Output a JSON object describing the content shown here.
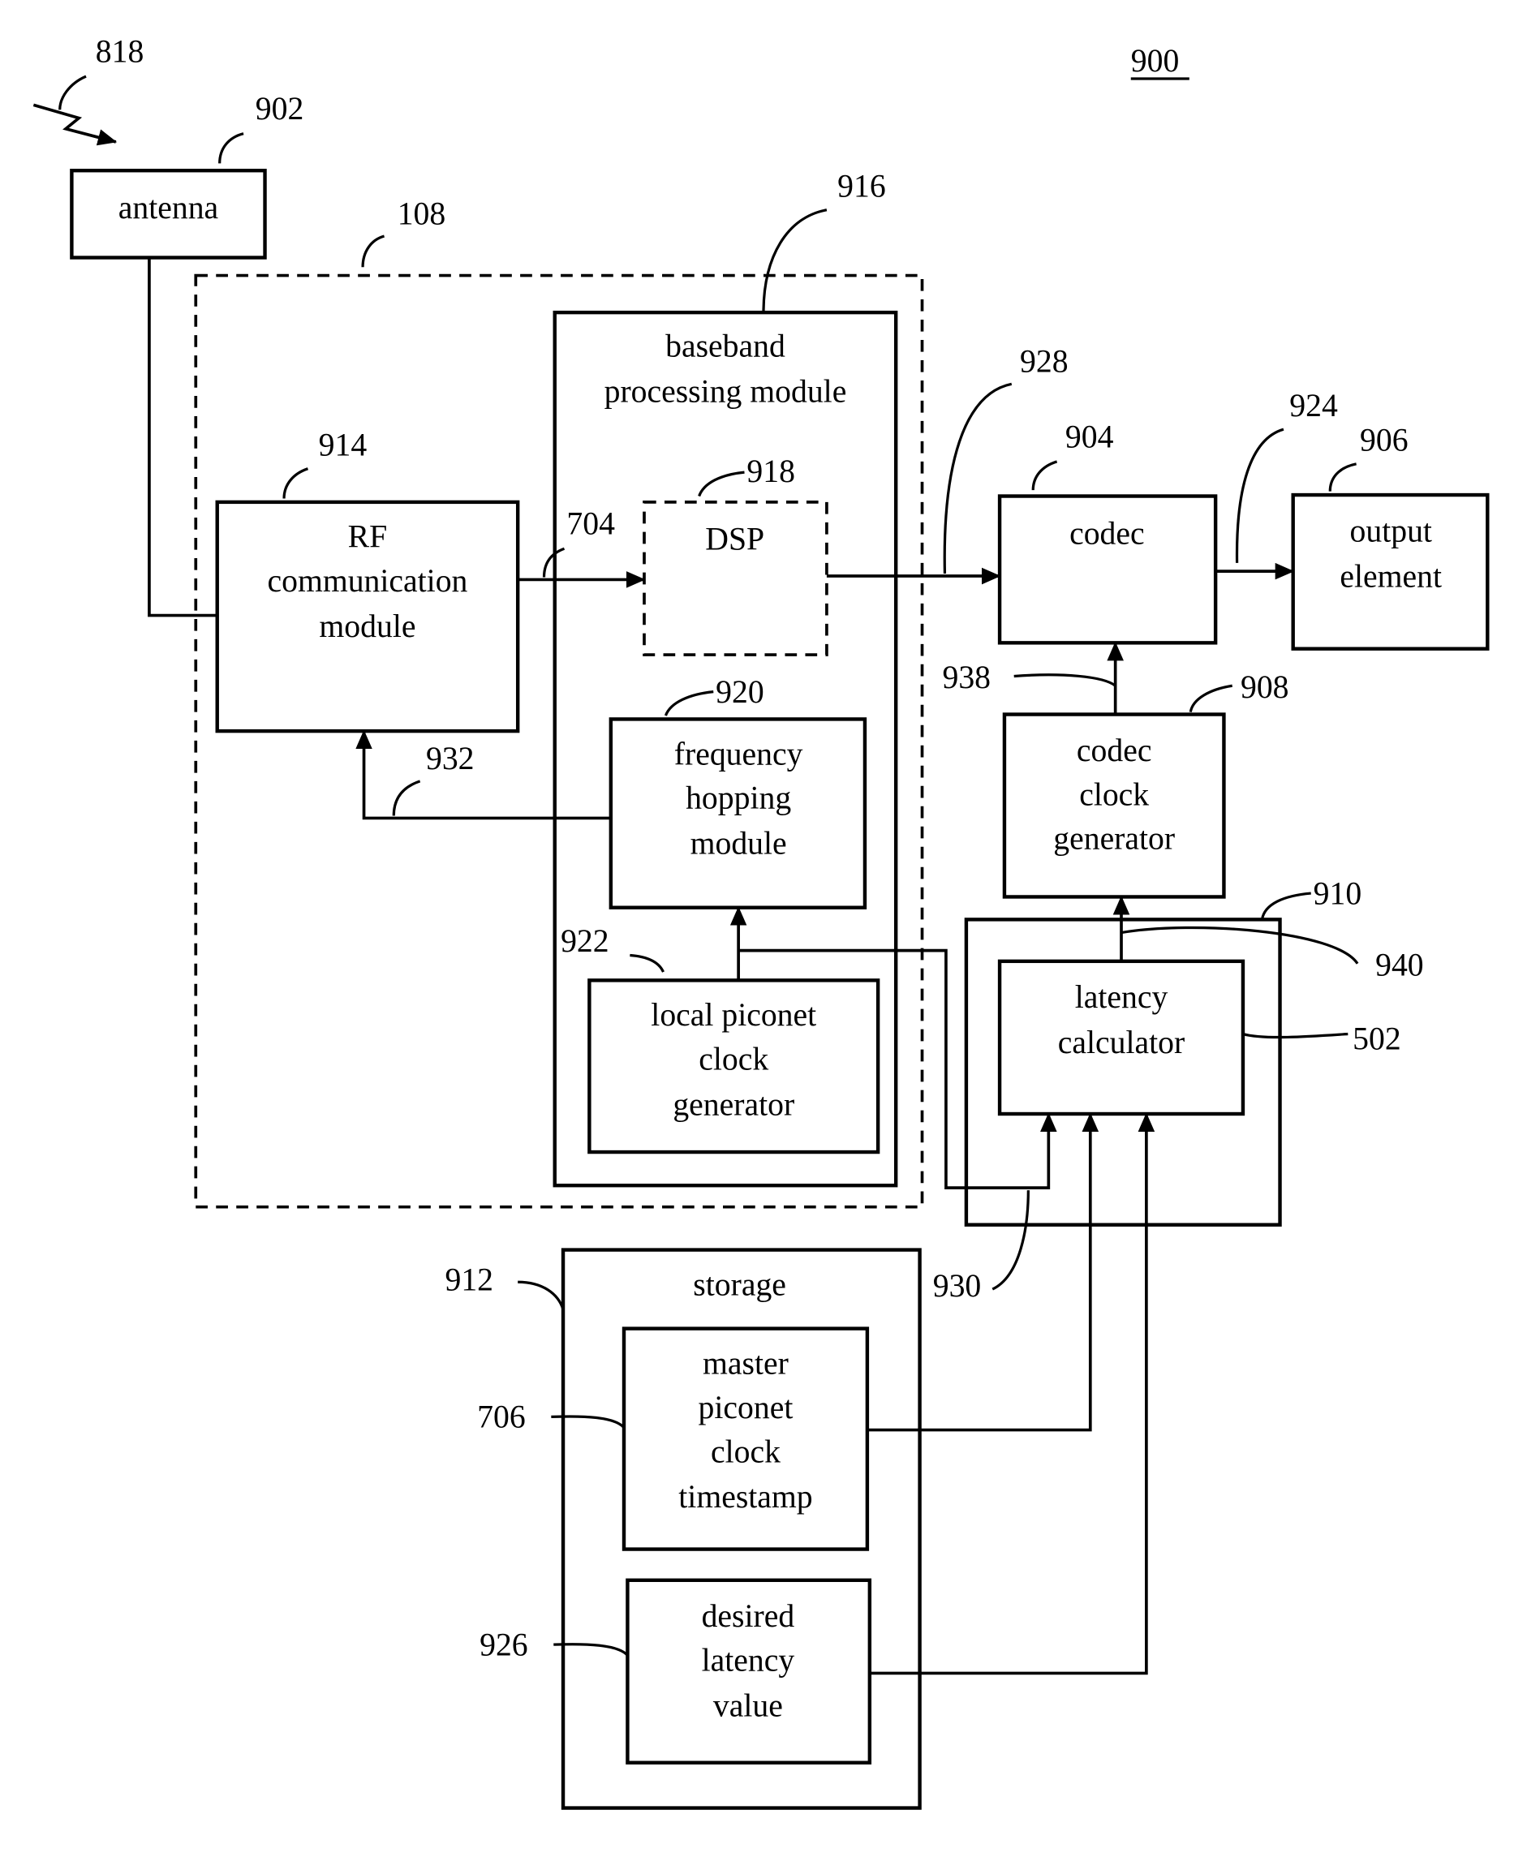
{
  "figure": {
    "figure_number": "900",
    "signal_ref": "818"
  },
  "blocks": {
    "antenna": {
      "label": [
        "antenna"
      ],
      "ref": "902"
    },
    "bluetooth_module": {
      "ref": "108"
    },
    "baseband": {
      "label": [
        "baseband",
        "processing module"
      ],
      "ref": "916"
    },
    "rf": {
      "label": [
        "RF",
        "communication",
        "module"
      ],
      "ref": "914"
    },
    "dsp": {
      "label": [
        "DSP"
      ],
      "ref": "918"
    },
    "freq_hopping": {
      "label": [
        "frequency",
        "hopping",
        "module"
      ],
      "ref": "920"
    },
    "local_clock": {
      "label": [
        "local piconet",
        "clock",
        "generator"
      ],
      "ref": "922"
    },
    "codec": {
      "label": [
        "codec"
      ],
      "ref": "904"
    },
    "output": {
      "label": [
        "output",
        "element"
      ],
      "ref": "906"
    },
    "codec_clock": {
      "label": [
        "codec",
        "clock",
        "generator"
      ],
      "ref": "908"
    },
    "controller": {
      "ref": "910"
    },
    "latency_calc": {
      "label": [
        "latency",
        "calculator"
      ],
      "ref": "502"
    },
    "storage": {
      "label": [
        "storage"
      ],
      "ref": "912"
    },
    "master_ts": {
      "label": [
        "master",
        "piconet",
        "clock",
        "timestamp"
      ],
      "ref": "706"
    },
    "desired_latency": {
      "label": [
        "desired",
        "latency",
        "value"
      ],
      "ref": "926"
    }
  },
  "connections": {
    "rf_to_dsp": "704",
    "dsp_to_codec": "928",
    "codec_to_output": "924",
    "codec_clock_to_codec": "938",
    "latency_to_codec_clock": "940",
    "freq_hop_to_rf": "932",
    "local_clock_to_latency": "930"
  }
}
